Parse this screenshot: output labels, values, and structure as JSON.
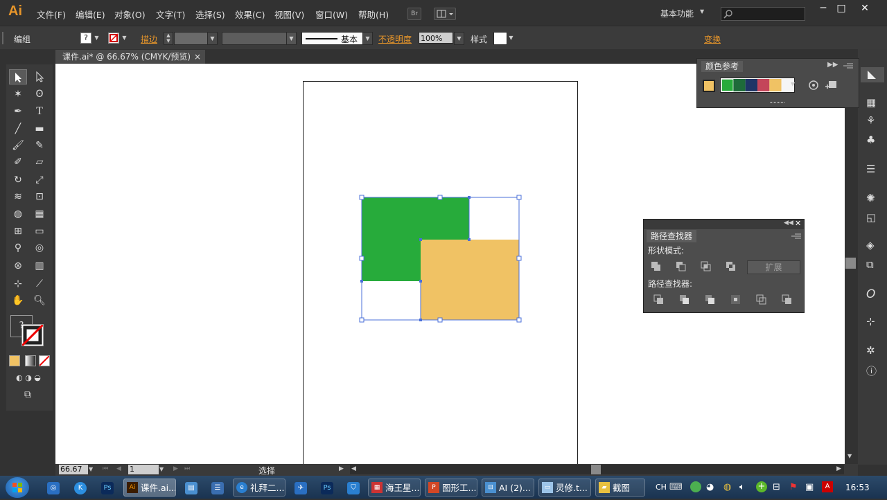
{
  "app": {
    "logo": "Ai",
    "bridge": "Br"
  },
  "menu": [
    "文件(F)",
    "编辑(E)",
    "对象(O)",
    "文字(T)",
    "选择(S)",
    "效果(C)",
    "视图(V)",
    "窗口(W)",
    "帮助(H)"
  ],
  "workspace": "基本功能",
  "control": {
    "group_label": "编组",
    "stroke_label": "描边",
    "stroke_style": "基本",
    "opacity_label": "不透明度",
    "opacity_value": "100%",
    "style_label": "样式",
    "transform_label": "变换",
    "fill_icon": "?"
  },
  "document": {
    "tab_title": "课件.ai* @ 66.67% (CMYK/预览)",
    "close": "×"
  },
  "toolbox": {
    "fill_unknown": "?"
  },
  "color_guide": {
    "title": "颜色参考",
    "base_color": "#F0C264",
    "swatches": [
      "#27AB3B",
      "#1E6B3A",
      "#1F3566",
      "#C4465A",
      "#F0C264",
      "#F5F5F5"
    ]
  },
  "artwork": {
    "green": "#27AB3B",
    "yellow": "#F0C264",
    "selection": "#4A6FD8"
  },
  "pathfinder": {
    "title": "路径查找器",
    "shape_modes": "形状模式:",
    "pathfinders": "路径查找器:",
    "expand": "扩展"
  },
  "status": {
    "zoom": "66.67",
    "page": "1",
    "tool": "选择"
  },
  "taskbar": {
    "apps": [
      "课件.ai...",
      "礼拜二...",
      "海王星...",
      "图形工...",
      "AI (2)...",
      "灵修.t...",
      "截图"
    ],
    "ime": "CH",
    "time": "16:53"
  }
}
